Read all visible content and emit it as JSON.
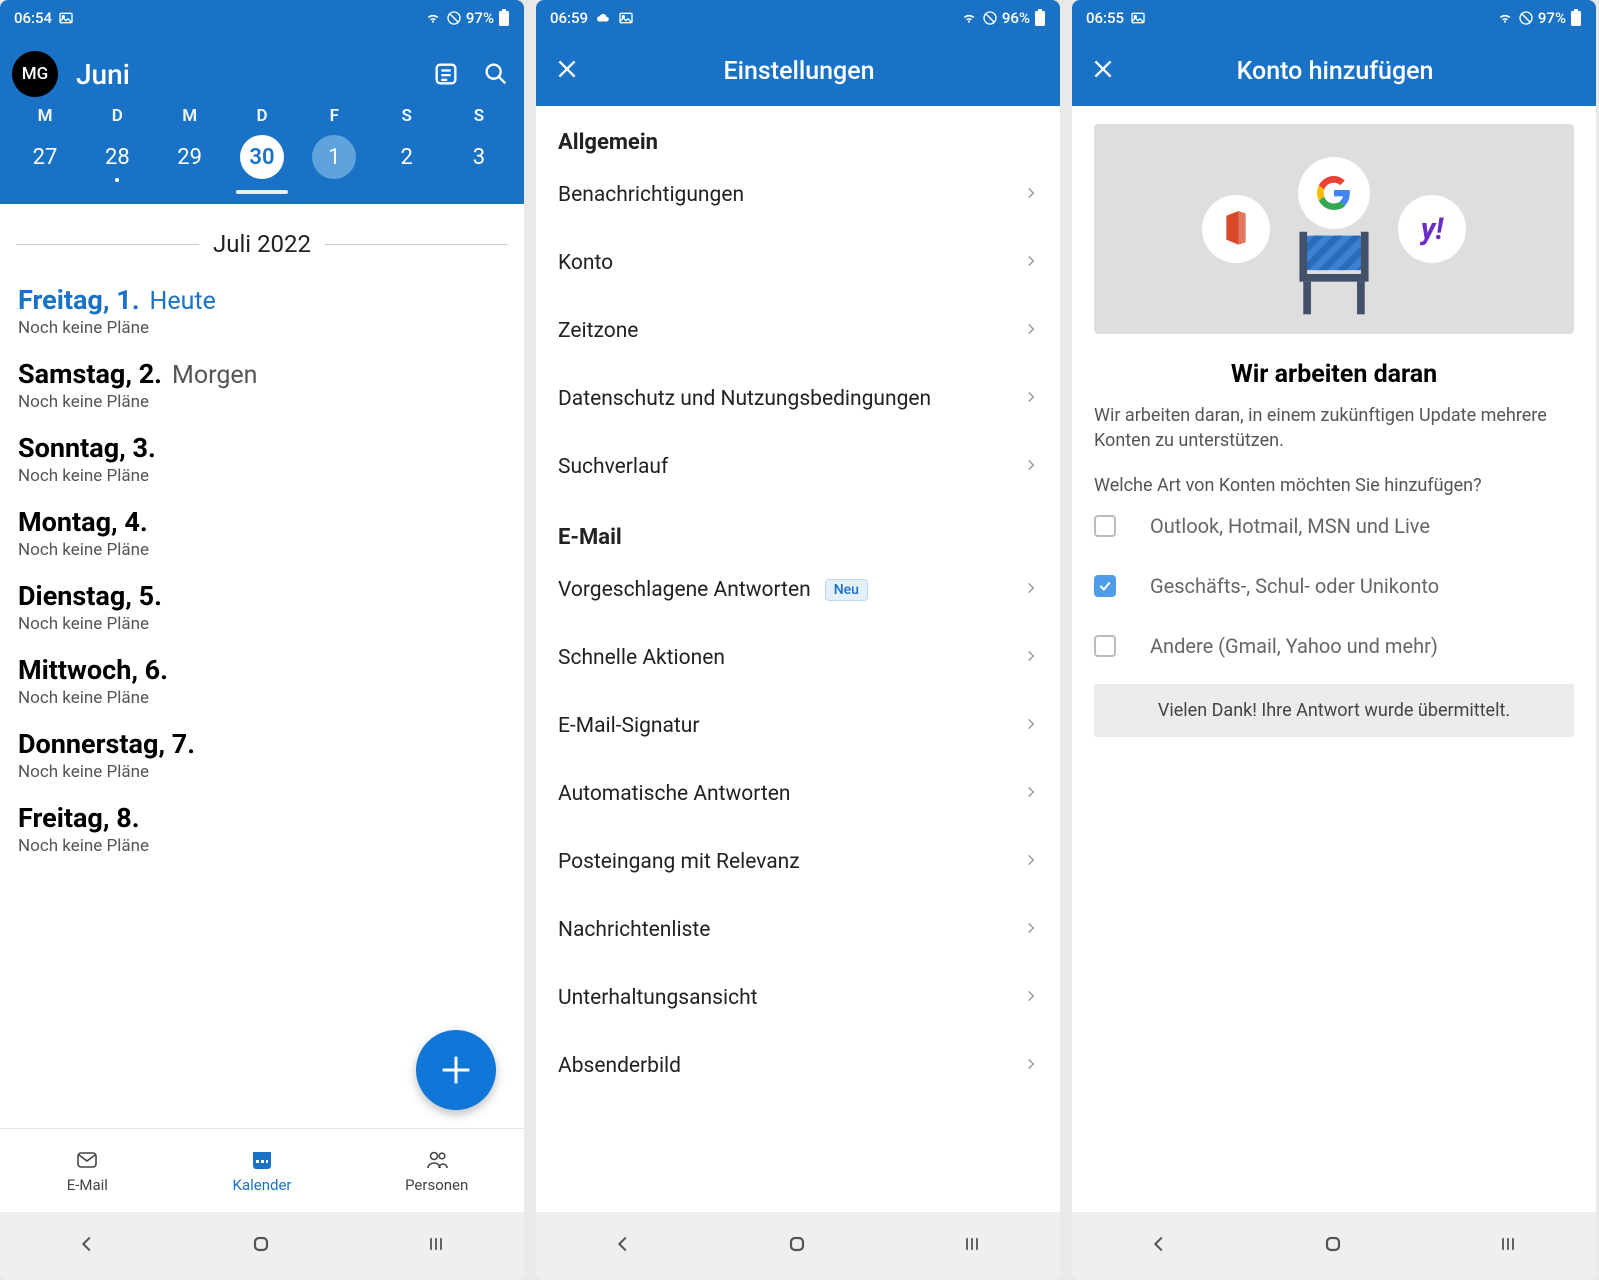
{
  "screens": {
    "calendar": {
      "status": {
        "time": "06:54",
        "battery": "97%"
      },
      "avatar": "MG",
      "month": "Juni",
      "weekdays": [
        "M",
        "D",
        "M",
        "D",
        "F",
        "S",
        "S"
      ],
      "dates": [
        "27",
        "28",
        "29",
        "30",
        "1",
        "2",
        "3"
      ],
      "selected_index": 3,
      "today_index": 4,
      "divider_month": "Juli 2022",
      "agenda": [
        {
          "day": "Freitag, 1.",
          "rel": "Heute",
          "sub": "Noch keine Pläne",
          "current": true
        },
        {
          "day": "Samstag, 2.",
          "rel": "Morgen",
          "sub": "Noch keine Pläne"
        },
        {
          "day": "Sonntag, 3.",
          "sub": "Noch keine Pläne"
        },
        {
          "day": "Montag, 4.",
          "sub": "Noch keine Pläne"
        },
        {
          "day": "Dienstag, 5.",
          "sub": "Noch keine Pläne"
        },
        {
          "day": "Mittwoch, 6.",
          "sub": "Noch keine Pläne"
        },
        {
          "day": "Donnerstag, 7.",
          "sub": "Noch keine Pläne"
        },
        {
          "day": "Freitag, 8.",
          "sub": "Noch keine Pläne"
        }
      ],
      "tabs": {
        "email": "E-Mail",
        "calendar": "Kalender",
        "people": "Personen"
      }
    },
    "settings": {
      "status": {
        "time": "06:59",
        "battery": "96%"
      },
      "title": "Einstellungen",
      "section_general": "Allgemein",
      "general_items": [
        "Benachrichtigungen",
        "Konto",
        "Zeitzone",
        "Datenschutz und Nutzungsbedingungen",
        "Suchverlauf"
      ],
      "section_email": "E-Mail",
      "email_items": [
        {
          "label": "Vorgeschlagene Antworten",
          "badge": "Neu"
        },
        {
          "label": "Schnelle Aktionen"
        },
        {
          "label": "E-Mail-Signatur"
        },
        {
          "label": "Automatische Antworten"
        },
        {
          "label": "Posteingang mit Relevanz"
        },
        {
          "label": "Nachrichtenliste"
        },
        {
          "label": "Unterhaltungsansicht"
        },
        {
          "label": "Absenderbild"
        }
      ]
    },
    "add_account": {
      "status": {
        "time": "06:55",
        "battery": "97%"
      },
      "title": "Konto hinzufügen",
      "heading": "Wir arbeiten daran",
      "body": "Wir arbeiten daran, in einem zukünftigen Update mehrere Konten zu unterstützen.",
      "question": "Welche Art von Konten möchten Sie hinzufügen?",
      "options": [
        {
          "label": "Outlook, Hotmail, MSN und Live",
          "checked": false
        },
        {
          "label": "Geschäfts-, Schul- oder Unikonto",
          "checked": true
        },
        {
          "label": "Andere (Gmail, Yahoo und mehr)",
          "checked": false
        }
      ],
      "thanks": "Vielen Dank! Ihre Antwort wurde übermittelt."
    }
  }
}
